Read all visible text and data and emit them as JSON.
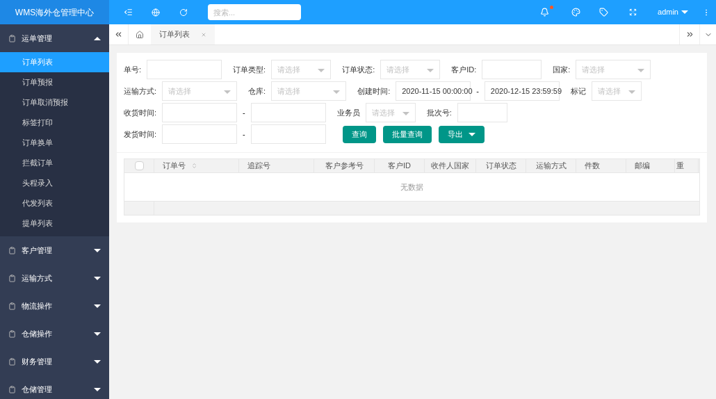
{
  "app_title": "WMS海外仓管理中心",
  "header": {
    "search_placeholder": "搜索...",
    "notification_dot": true,
    "user": "admin"
  },
  "sidebar": [
    {
      "label": "运单管理",
      "expanded": true,
      "children": [
        {
          "label": "订单列表",
          "selected": true
        },
        {
          "label": "订单预报",
          "selected": false
        },
        {
          "label": "订单取消预报",
          "selected": false
        },
        {
          "label": "标签打印",
          "selected": false
        },
        {
          "label": "订单换单",
          "selected": false
        },
        {
          "label": "拦截订单",
          "selected": false
        },
        {
          "label": "头程录入",
          "selected": false
        },
        {
          "label": "代发列表",
          "selected": false
        },
        {
          "label": "提单列表",
          "selected": false
        }
      ]
    },
    {
      "label": "客户管理",
      "expanded": false
    },
    {
      "label": "运输方式",
      "expanded": false
    },
    {
      "label": "物流操作",
      "expanded": false
    },
    {
      "label": "仓储操作",
      "expanded": false
    },
    {
      "label": "财务管理",
      "expanded": false
    },
    {
      "label": "仓储管理",
      "expanded": false
    }
  ],
  "tabs": [
    {
      "label": "订单列表"
    }
  ],
  "filters": [
    [
      {
        "label": "单号:",
        "kind": "input"
      },
      {
        "label": "订单类型:",
        "kind": "select",
        "placeholder": "请选择"
      },
      {
        "label": "订单状态:",
        "kind": "select",
        "placeholder": "请选择"
      },
      {
        "label": "客户ID:",
        "kind": "input"
      },
      {
        "label": "国家:",
        "kind": "select",
        "placeholder": "请选择"
      }
    ],
    [
      {
        "label": "运输方式:",
        "kind": "select",
        "placeholder": "请选择"
      },
      {
        "label": "仓库:",
        "kind": "select",
        "placeholder": "请选择"
      },
      {
        "label": "创建时间:",
        "kind": "range",
        "from": "2020-11-15 00:00:00",
        "separator": "-",
        "to": "2020-12-15 23:59:59"
      },
      {
        "label": "标记",
        "kind": "select",
        "placeholder": "请选择"
      }
    ],
    [
      {
        "label": "收货时间:",
        "kind": "range",
        "separator": "-"
      },
      {
        "label": "业务员",
        "kind": "select",
        "placeholder": "请选择"
      },
      {
        "label": "批次号:",
        "kind": "input"
      }
    ],
    [
      {
        "label": "发货时间:",
        "kind": "range",
        "separator": "-"
      }
    ]
  ],
  "buttons": [
    {
      "label": "查询",
      "dropdown": false
    },
    {
      "label": "批量查询",
      "dropdown": false
    },
    {
      "label": "导出",
      "dropdown": true
    }
  ],
  "table": {
    "select_all_checked": false,
    "columns": [
      {
        "label": "订单号",
        "sortable": true
      },
      {
        "label": "追踪号",
        "sortable": false
      },
      {
        "label": "客户参考号",
        "sortable": false
      },
      {
        "label": "客户ID",
        "sortable": false
      },
      {
        "label": "收件人国家",
        "sortable": false
      },
      {
        "label": "订单状态",
        "sortable": false
      },
      {
        "label": "运输方式",
        "sortable": false
      },
      {
        "label": "件数",
        "sortable": false
      },
      {
        "label": "邮编",
        "sortable": false
      },
      {
        "label": "重",
        "sortable": false
      }
    ],
    "empty_text": "无数据"
  }
}
